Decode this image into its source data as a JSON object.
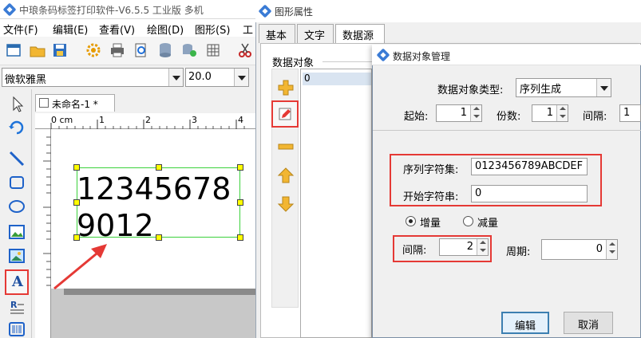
{
  "app": {
    "title": "中琅条码标签打印软件-V6.5.5 工业版 多机",
    "menu": [
      "文件(F)",
      "编辑(E)",
      "查看(V)",
      "绘图(D)",
      "图形(S)",
      "工"
    ],
    "font_name": "微软雅黑",
    "font_size": "20.0",
    "doc_tab": "未命名-1 *",
    "ruler_origin": "0 cm",
    "ruler_ticks": [
      "1",
      "2",
      "3",
      "4"
    ],
    "canvas_text_line1": "12345678",
    "canvas_text_line2": "9012"
  },
  "props": {
    "title": "图形属性",
    "tabs": [
      "基本",
      "文字",
      "数据源"
    ],
    "data_objects_label": "数据对象",
    "list_items": [
      "0"
    ]
  },
  "dialog": {
    "title": "数据对象管理",
    "type_label": "数据对象类型:",
    "type_value": "序列生成",
    "start_label": "起始:",
    "start_value": "1",
    "copies_label": "份数:",
    "copies_value": "1",
    "interval_top_label": "间隔:",
    "interval_top_value": "1",
    "charset_label": "序列字符集:",
    "charset_value": "0123456789ABCDEF",
    "start_string_label": "开始字符串:",
    "start_string_value": "0",
    "increase_label": "增量",
    "decrease_label": "减量",
    "step_label": "间隔:",
    "step_value": "2",
    "cycle_label": "周期:",
    "cycle_value": "0",
    "edit_button": "编辑",
    "cancel_button": "取消"
  },
  "colors": {
    "highlight_red": "#e53935",
    "selection_green": "#3bd13b",
    "handle_yellow": "#ffff00"
  }
}
